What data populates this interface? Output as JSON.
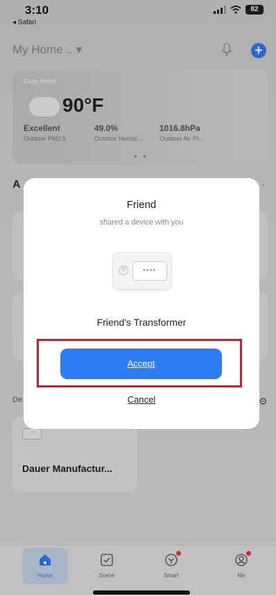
{
  "status": {
    "time": "3:10",
    "back_app": "◂ Safari",
    "battery": "82"
  },
  "header": {
    "home_title": "My Home ..",
    "mic_icon": "mic-icon",
    "add_icon": "plus-icon"
  },
  "weather": {
    "location": "Cozy Home",
    "temperature": "90°F",
    "stats": [
      {
        "value": "Excellent",
        "label": "Outdoor PM2.5"
      },
      {
        "value": "49.0%",
        "label": "Outdoor Humid..."
      },
      {
        "value": "1016.8hPa",
        "label": "Outdoor Air Pr..."
      }
    ]
  },
  "sections": {
    "a_label": "A",
    "d_label": "De"
  },
  "device_card": {
    "name": "Dauer Manufactur...",
    "thumb": "· ∵∵"
  },
  "modal": {
    "title": "Friend",
    "subtitle": "shared a device with you",
    "device_name": "Friend's Transformer",
    "outlet_glyph": "▪▪▪▪",
    "accept_label": "Accept",
    "cancel_label": "Cancel"
  },
  "tabs": [
    {
      "label": "Home",
      "icon": "home-icon",
      "active": true
    },
    {
      "label": "Scene",
      "icon": "checkbox-icon"
    },
    {
      "label": "Smart",
      "icon": "smart-icon",
      "badge": true
    },
    {
      "label": "Me",
      "icon": "profile-icon",
      "badge": true
    }
  ],
  "colors": {
    "accent": "#2f7cf6",
    "highlight": "#c8202f",
    "badge": "#e63b2e"
  }
}
